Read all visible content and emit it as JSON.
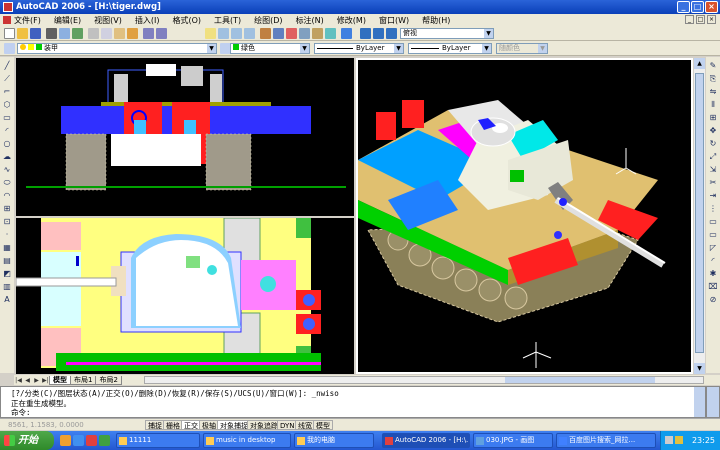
{
  "window": {
    "title": "AutoCAD 2006 - [H:\\tiger.dwg]"
  },
  "menu": [
    "文件(F)",
    "编辑(E)",
    "视图(V)",
    "插入(I)",
    "格式(O)",
    "工具(T)",
    "绘图(D)",
    "标注(N)",
    "修改(M)",
    "窗口(W)",
    "帮助(H)"
  ],
  "toolbar": {
    "view_combo": "俯视",
    "layer_combo": "装甲",
    "color_combo": "绿色",
    "linetype_combo": "ByLayer",
    "lineweight_combo": "ByLayer",
    "plotstyle_combo": "随颜色"
  },
  "tabs": [
    "模型",
    "布局1",
    "布局2"
  ],
  "command": {
    "line1": "[?/分类(C)/图层状态(A)/正交(O)/删除(D)/恢复(R)/保存(S)/UCS(U)/窗口(W)]: _nwiso",
    "line2": "正在重生成模型。",
    "prompt": "命令:"
  },
  "status": {
    "coords": "8561, 1.1583, 0.0000",
    "buttons": [
      "捕捉",
      "栅格",
      "正交",
      "极轴",
      "对象捕捉",
      "对象追踪",
      "DYN",
      "线宽",
      "模型"
    ]
  },
  "taskbar": {
    "start": "开始",
    "tasks": [
      "11111",
      "music in desktop",
      "我的电脑",
      "AutoCAD 2006 - [H:\\...",
      "030.JPG - 画图",
      "百度图片搜索_网拉..."
    ],
    "clock": "23:25"
  },
  "colors": {
    "viewport_bg": "#000000",
    "titlebar": "#0a3fb8",
    "taskbar": "#2457d0"
  }
}
